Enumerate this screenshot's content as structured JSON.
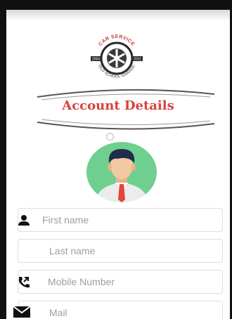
{
  "header": {
    "logo": {
      "top_text": "CAR SERVICE",
      "bottom_text": "OLD SCHOOL GARAGE",
      "left_year": "2004",
      "right_year": "2011",
      "icon": "wheel-icon"
    },
    "title": "Account Details"
  },
  "avatar": {
    "icon": "user-avatar-icon"
  },
  "form": {
    "first_name": {
      "placeholder": "First name",
      "value": "",
      "icon": "person-icon"
    },
    "last_name": {
      "placeholder": "Last name",
      "value": ""
    },
    "mobile": {
      "placeholder": "Mobile Number",
      "value": "",
      "icon": "phone-icon"
    },
    "mail": {
      "placeholder": "Mail",
      "value": "",
      "icon": "mail-icon"
    }
  },
  "colors": {
    "title": "#d8423b",
    "field_border": "#dedede",
    "placeholder": "#9e9e9e",
    "avatar_bg": "#6fcf8e",
    "tie": "#e2463d"
  }
}
